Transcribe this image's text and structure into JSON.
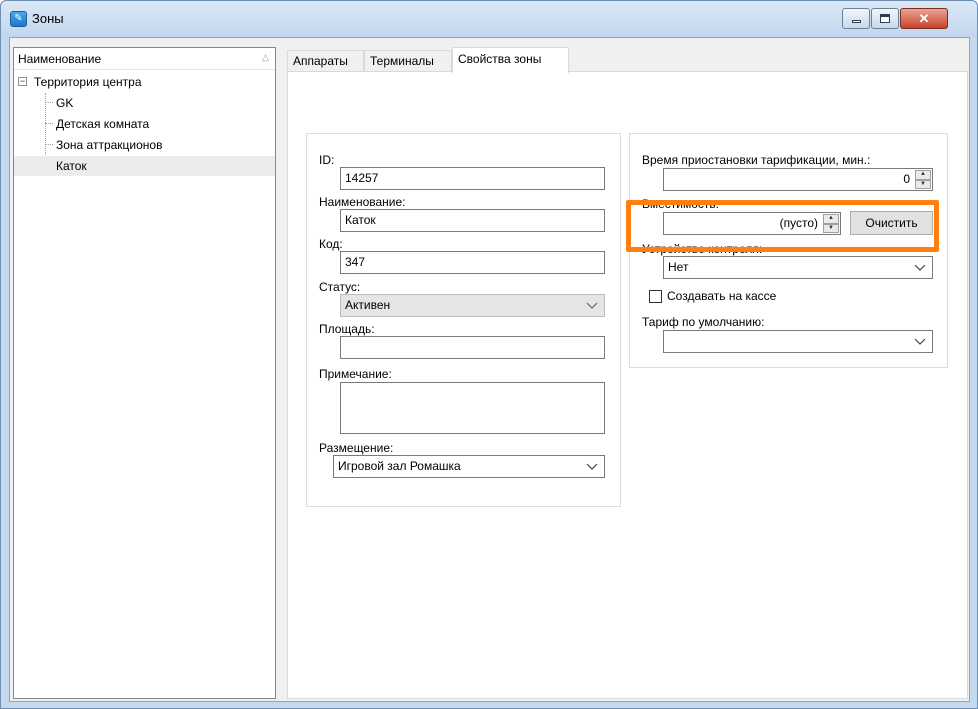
{
  "window": {
    "title": "Зоны"
  },
  "tree": {
    "header": "Наименование",
    "root": "Территория центра",
    "items": [
      "GK",
      "Детская комната",
      "Зона аттракционов",
      "Каток"
    ]
  },
  "tabs": [
    "Аппараты",
    "Терминалы",
    "Свойства зоны"
  ],
  "props": {
    "id_label": "ID:",
    "id_value": "14257",
    "name_label": "Наименование:",
    "name_value": "Каток",
    "code_label": "Код:",
    "code_value": "347",
    "status_label": "Статус:",
    "status_value": "Активен",
    "area_label": "Площадь:",
    "area_value": "",
    "note_label": "Примечание:",
    "note_value": "",
    "placement_label": "Размещение:",
    "placement_value": "Игровой зал Ромашка",
    "suspend_label": "Время приостановки тарификации, мин.:",
    "suspend_value": "0",
    "capacity_label": "Вместимость:",
    "capacity_value": "(пусто)",
    "clear_button": "Очистить",
    "control_label": "Устройство контроля:",
    "control_value": "Нет",
    "create_label": "Создавать на кассе",
    "tariff_label": "Тариф по умолчанию:",
    "tariff_value": ""
  },
  "colors": {
    "highlight": "#ff7f10"
  }
}
